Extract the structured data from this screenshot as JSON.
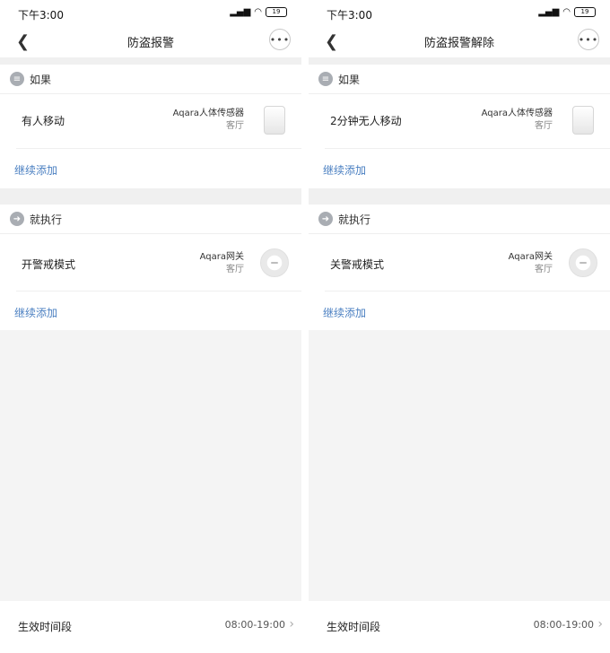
{
  "screens": [
    {
      "status": {
        "time": "下午3:00",
        "alarm_icons": "♙ ⏰",
        "battery": "19"
      },
      "title": "防盗报警",
      "if_section": {
        "label": "如果",
        "row": {
          "main": "有人移动",
          "device": "Aqara人体传感器",
          "room": "客厅",
          "icon": "motion-sensor-icon"
        },
        "add_label": "继续添加"
      },
      "then_section": {
        "label": "就执行",
        "row": {
          "main": "开警戒模式",
          "device": "Aqara网关",
          "room": "客厅",
          "icon": "gateway-icon"
        },
        "add_label": "继续添加"
      },
      "effective": {
        "label": "生效时间段",
        "value": "08:00-19:00"
      }
    },
    {
      "status": {
        "time": "下午3:00",
        "alarm_icons": "♙ ⏰",
        "battery": "19"
      },
      "title": "防盗报警解除",
      "if_section": {
        "label": "如果",
        "row": {
          "main": "2分钟无人移动",
          "device": "Aqara人体传感器",
          "room": "客厅",
          "icon": "motion-sensor-icon"
        },
        "add_label": "继续添加"
      },
      "then_section": {
        "label": "就执行",
        "row": {
          "main": "关警戒模式",
          "device": "Aqara网关",
          "room": "客厅",
          "icon": "gateway-icon"
        },
        "add_label": "继续添加"
      },
      "effective": {
        "label": "生效时间段",
        "value": "08:00-19:00"
      }
    }
  ]
}
